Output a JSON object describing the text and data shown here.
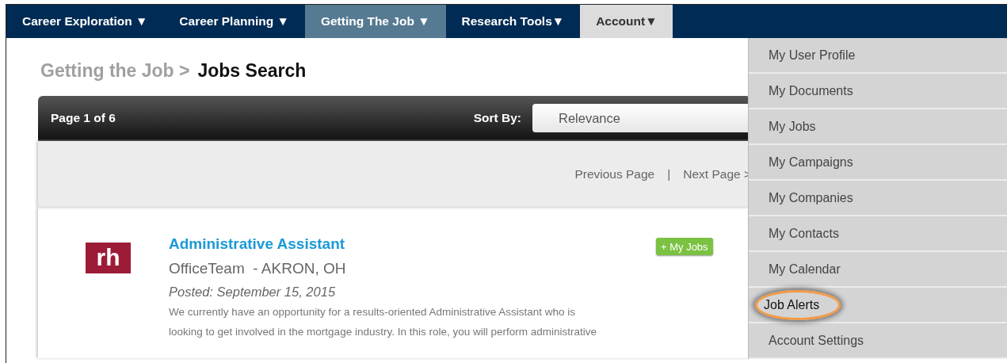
{
  "nav": {
    "tabs": [
      {
        "label": "Career Exploration ▼",
        "selected": false,
        "expanded": false
      },
      {
        "label": "Career Planning ▼",
        "selected": false,
        "expanded": false
      },
      {
        "label": "Getting The Job ▼",
        "selected": true,
        "expanded": false
      },
      {
        "label": "Research Tools▼",
        "selected": false,
        "expanded": false
      },
      {
        "label": "Account▼",
        "selected": false,
        "expanded": true
      }
    ]
  },
  "account_menu": {
    "items": [
      {
        "label": "My User Profile",
        "highlighted": false
      },
      {
        "label": "My Documents",
        "highlighted": false
      },
      {
        "label": "My Jobs",
        "highlighted": false
      },
      {
        "label": "My Campaigns",
        "highlighted": false
      },
      {
        "label": "My Companies",
        "highlighted": false
      },
      {
        "label": "My Contacts",
        "highlighted": false
      },
      {
        "label": "My Calendar",
        "highlighted": false
      },
      {
        "label": "Job Alerts",
        "highlighted": true
      },
      {
        "label": "Account Settings",
        "highlighted": false
      }
    ]
  },
  "breadcrumb": {
    "parent": "Getting the Job >",
    "current": "Jobs Search"
  },
  "toolbar": {
    "page": "Page 1 of 6",
    "sort_label": "Sort By:",
    "sort_value": "Relevance"
  },
  "pager": {
    "previous": "Previous Page",
    "separator": "|",
    "next": "Next Page >"
  },
  "job": {
    "title": "Administrative Assistant",
    "company": "OfficeTeam  - AKRON, OH",
    "posted": "Posted: September 15, 2015",
    "add_button": "+ My Jobs",
    "logo_text": "rh",
    "description_lines": [
      "We currently have an opportunity for a results-oriented Administrative Assistant who is",
      "looking to get involved in the mortgage industry. In this role, you will perform administrative"
    ]
  }
}
